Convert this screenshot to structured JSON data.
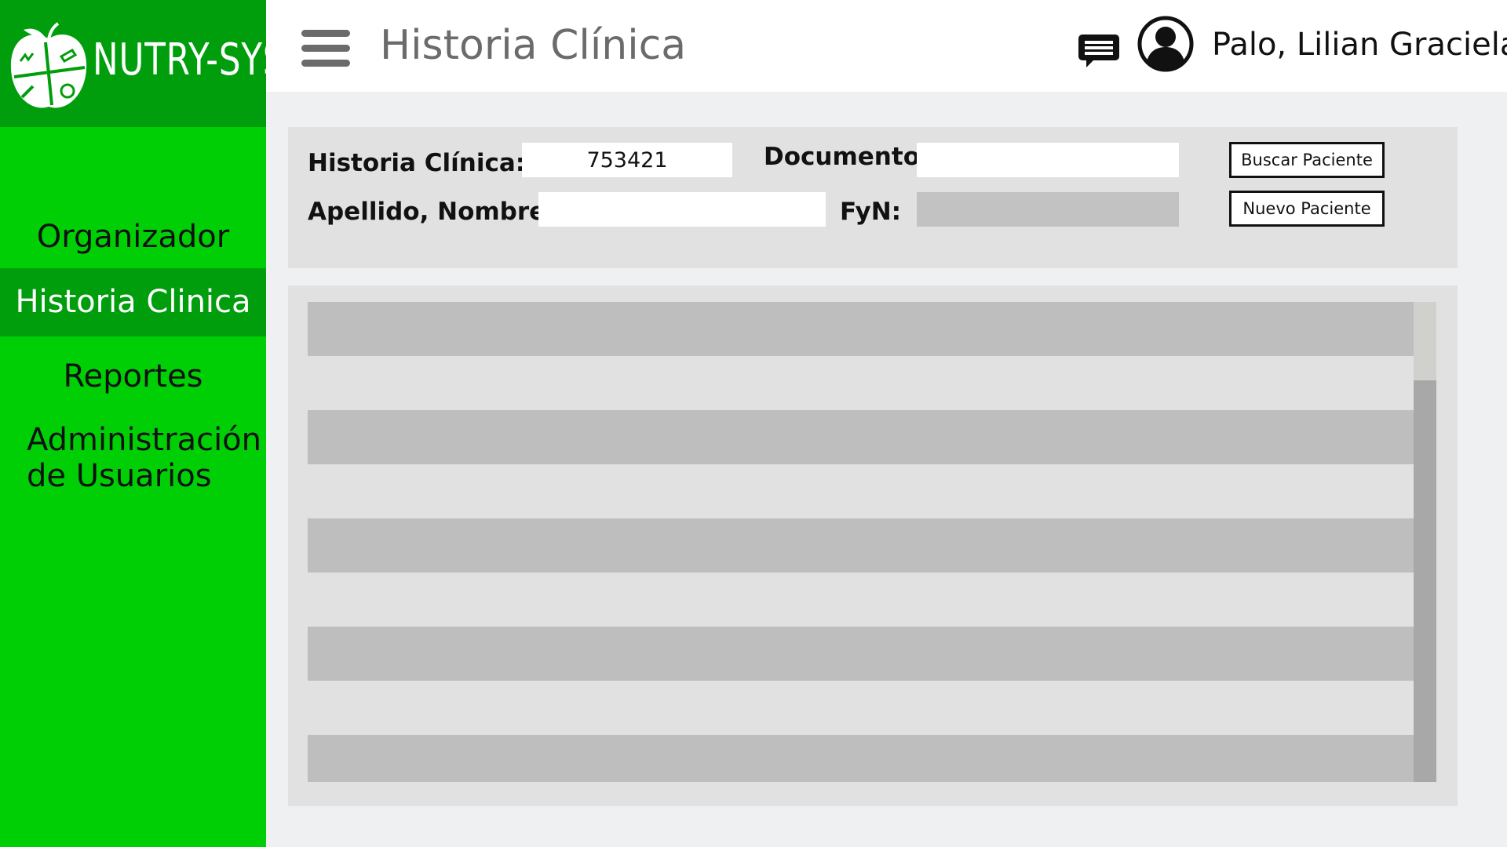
{
  "app": {
    "brand_name": "NUTRY-SYS",
    "colors": {
      "sidebar": "#00cf06",
      "sidebar_active": "#009e0c",
      "panel": "#e1e1e1",
      "row": "#bebebe"
    }
  },
  "sidebar": {
    "items": [
      {
        "label": "Organizador",
        "active": false
      },
      {
        "label": "Historia Clinica",
        "active": true
      },
      {
        "label": "Reportes",
        "active": false
      },
      {
        "label": "Administración de Usuarios",
        "active": false
      }
    ]
  },
  "header": {
    "title": "Historia Clínica",
    "menu_icon": "hamburger-icon",
    "chat_icon": "chat-icon",
    "avatar_icon": "user-avatar-icon",
    "user_name": "Palo, Lilian Graciela"
  },
  "search": {
    "historia_label": "Historia Clínica:",
    "historia_value": "753421",
    "documento_label": "Documento:",
    "documento_value": "",
    "apellido_label": "Apellido, Nombre:",
    "apellido_value": "",
    "fyn_label": "FyN:",
    "fyn_value": "",
    "buscar_button": "Buscar Paciente",
    "nuevo_button": "Nuevo Paciente"
  }
}
